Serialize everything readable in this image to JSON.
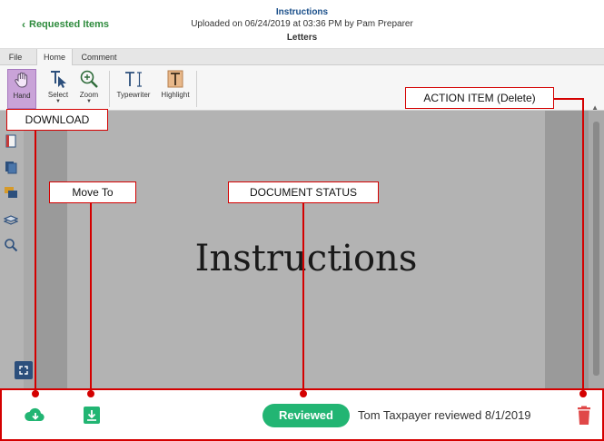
{
  "header": {
    "back_label": "Requested Items",
    "title": "Instructions",
    "subtitle": "Uploaded on 06/24/2019 at 03:36 PM by Pam Preparer",
    "document_name": "Letters"
  },
  "ribbon": {
    "tabs": [
      {
        "label": "File",
        "active": false
      },
      {
        "label": "Home",
        "active": true
      },
      {
        "label": "Comment",
        "active": false
      }
    ],
    "tools": [
      {
        "label": "Hand",
        "icon": "hand-icon",
        "active": true
      },
      {
        "label": "Select",
        "icon": "select-cursor-icon",
        "active": false
      },
      {
        "label": "Zoom",
        "icon": "zoom-icon",
        "active": false
      },
      {
        "label": "Typewriter",
        "icon": "typewriter-icon",
        "active": false
      },
      {
        "label": "Highlight",
        "icon": "highlight-icon",
        "active": false
      }
    ]
  },
  "viewer": {
    "document_heading": "Instructions",
    "rail_icons": [
      "thumbnails-icon",
      "pages-icon",
      "comments-icon",
      "layers-icon",
      "search-icon"
    ]
  },
  "footer": {
    "status_label": "Reviewed",
    "status_detail": "Tom Taxpayer reviewed 8/1/2019",
    "download_icon": "cloud-download-icon",
    "move_icon": "move-to-icon",
    "delete_icon": "trash-icon"
  },
  "annotations": {
    "download": "DOWNLOAD",
    "move_to": "Move To",
    "document_status": "DOCUMENT STATUS",
    "action_item": "ACTION ITEM (Delete)"
  },
  "colors": {
    "accent_green": "#22b573",
    "link_green": "#2e8b3d",
    "title_blue": "#1a4f8a",
    "annotation_red": "#d40000",
    "delete_red": "#e04848",
    "active_tool": "#c9a3d8"
  }
}
